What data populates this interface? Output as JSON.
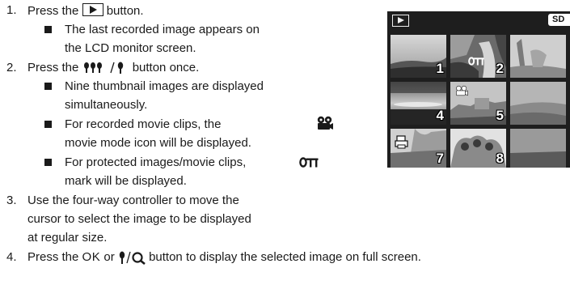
{
  "steps": [
    {
      "num": "1.",
      "before": "Press the ",
      "icon": "play-button-icon",
      "after": " button."
    },
    {
      "num": "2.",
      "before": "Press the ",
      "icon": "thumbnail-button-icon",
      "after": " button once."
    },
    {
      "num": "3.",
      "lines": [
        "Use the four-way controller to move the",
        "cursor to select the image to be displayed",
        "at regular size."
      ]
    },
    {
      "num": "4.",
      "before": "Press the ",
      "ok": "OK",
      "or": " or ",
      "icon": "zoom-button-icon",
      "after": " button to display the selected image on full screen."
    }
  ],
  "sub": {
    "s1_b1": [
      "The last recorded image appears on",
      "the LCD monitor screen."
    ],
    "s2_b1": [
      "Nine thumbnail images are displayed",
      "simultaneously."
    ],
    "s2_b2_pre": "For recorded movie clips, the ",
    "s2_b2_icon": "movie-mode-icon",
    "s2_b2_l2": "movie mode icon will be displayed.",
    "s2_b3_pre": "For protected images/movie clips, ",
    "s2_b3_icon": "protect-key-icon",
    "s2_b3_l2": "mark will be displayed."
  },
  "lcd": {
    "sd_label": "SD",
    "thumb_numbers": [
      "1",
      "2",
      "4",
      "5",
      "7",
      "8"
    ]
  }
}
